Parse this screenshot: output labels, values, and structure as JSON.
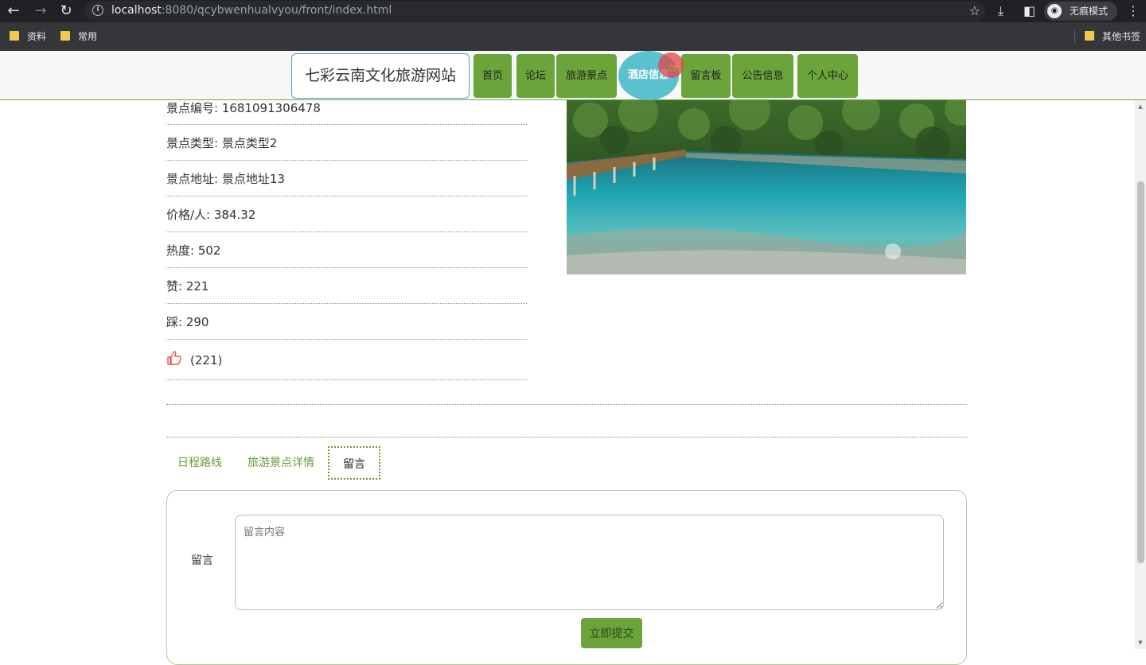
{
  "browser": {
    "url_host": "localhost",
    "url_rest": ":8080/qcybwenhualvyou/front/index.html",
    "incognito_label": "无痕模式",
    "bookmarks": [
      "资料",
      "常用"
    ],
    "other_bookmarks": "其他书签"
  },
  "site": {
    "title": "七彩云南文化旅游网站",
    "nav": [
      "首页",
      "论坛",
      "旅游景点",
      "酒店信息",
      "留言板",
      "公告信息",
      "个人中心"
    ],
    "active_nav": "酒店信息"
  },
  "detail": {
    "rows": [
      "景点编号: 1681091306478",
      "景点类型: 景点类型2",
      "景点地址: 景点地址13",
      "价格/人: 384.32",
      "热度: 502",
      "赞: 221",
      "踩: 290"
    ],
    "like_count": "(221)",
    "like_icon": "thumbs-up-icon"
  },
  "tabs": [
    "日程路线",
    "旅游景点详情",
    "留言"
  ],
  "active_tab": "留言",
  "message": {
    "label": "留言",
    "placeholder": "留言内容",
    "submit_label": "立即提交"
  },
  "colors": {
    "nav_green": "#6aa43a",
    "active_teal": "#5bc0cf",
    "like_red": "#e05a4a"
  }
}
